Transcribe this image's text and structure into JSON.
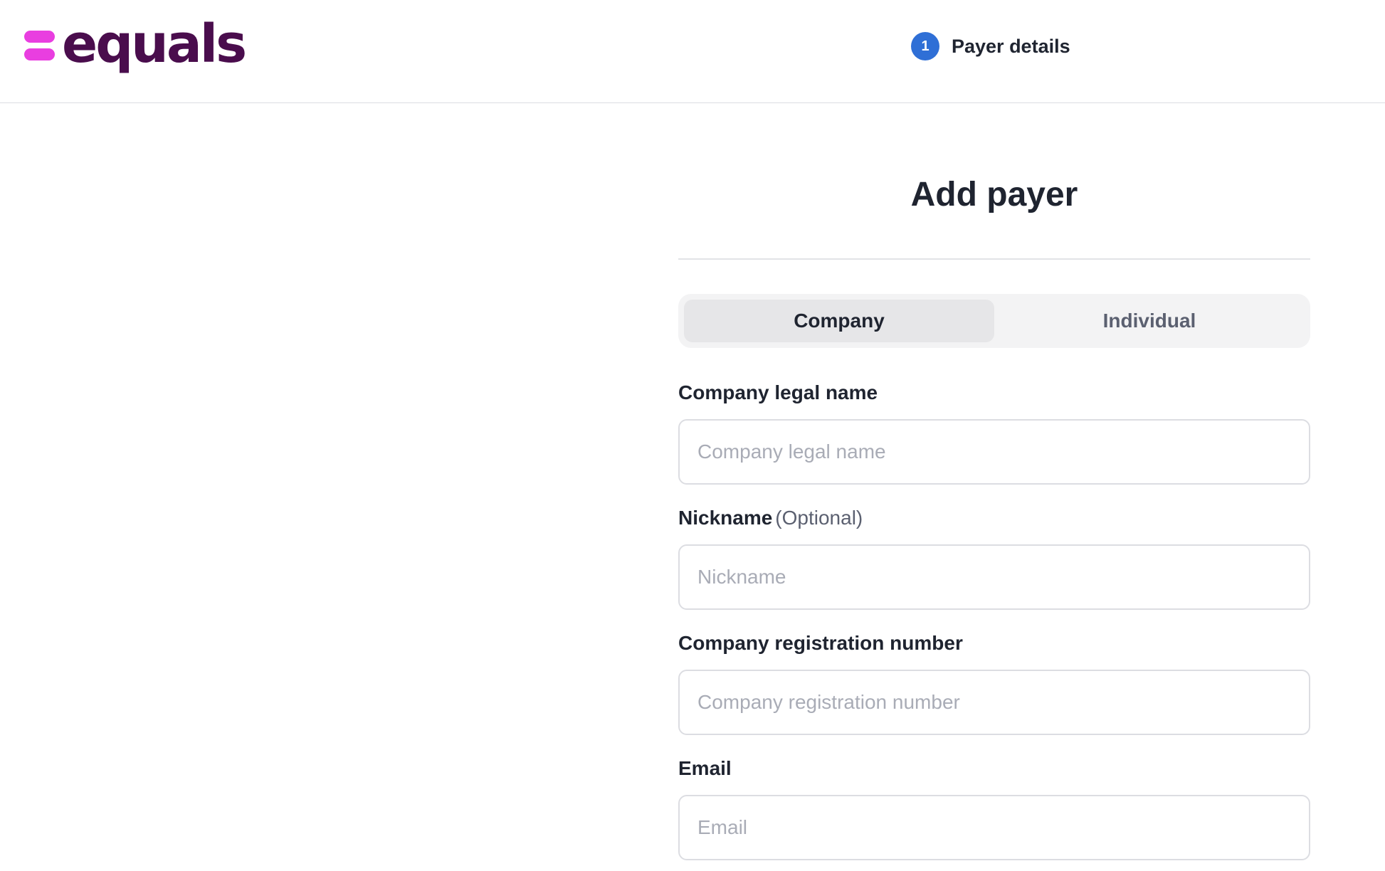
{
  "header": {
    "logo_text": "equals",
    "step": {
      "number": "1",
      "label": "Payer details"
    }
  },
  "main": {
    "title": "Add payer",
    "tabs": [
      {
        "label": "Company",
        "selected": true
      },
      {
        "label": "Individual",
        "selected": false
      }
    ],
    "fields": [
      {
        "label": "Company legal name",
        "placeholder": "Company legal name",
        "value": ""
      },
      {
        "label": "Nickname",
        "optional": "(Optional)",
        "placeholder": "Nickname",
        "value": ""
      },
      {
        "label": "Company registration number",
        "placeholder": "Company registration number",
        "value": ""
      },
      {
        "label": "Email",
        "placeholder": "Email",
        "value": ""
      }
    ]
  },
  "colors": {
    "brand_purple": "#4a0d4d",
    "brand_pink": "#e93ee0",
    "step_blue": "#2f6fd6"
  }
}
